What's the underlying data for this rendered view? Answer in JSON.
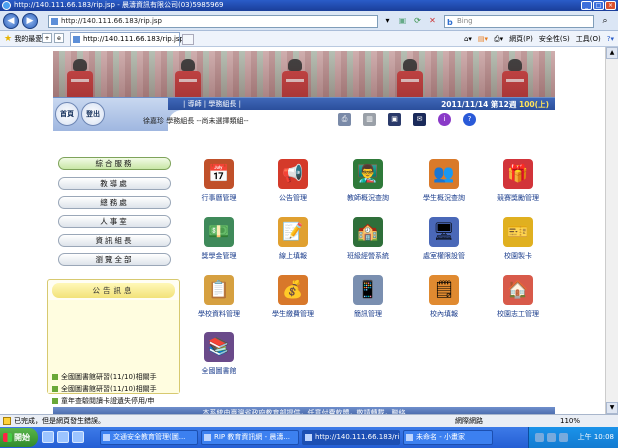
{
  "window": {
    "title": "http://140.111.66.183/rip.jsp - 晨濤資訊有限公司(03)5985969"
  },
  "addressbar": {
    "url": "http://140.111.66.183/rip.jsp",
    "search_engine": "Bing"
  },
  "favbar": {
    "favorites_label": "我的最愛",
    "tab_title": "http://140.111.66.183/rip.jsp",
    "tools": [
      "網頁(P)",
      "安全性(S)",
      "工具(O)"
    ]
  },
  "nav": {
    "home_label": "首頁",
    "logout_label": "登出",
    "role": "| 導師 | 學務組長 |",
    "date": "2011/11/14",
    "week": "第12週",
    "semester": "100(上)",
    "user": "徐嘉珍 學務組長 --尚未選擇類組--"
  },
  "menu": [
    {
      "label": "綜合服務",
      "active": true
    },
    {
      "label": "教導處",
      "active": false
    },
    {
      "label": "總務處",
      "active": false
    },
    {
      "label": "人事室",
      "active": false
    },
    {
      "label": "資訊組長",
      "active": false
    },
    {
      "label": "瀏覽全部",
      "active": false
    }
  ],
  "announcements": {
    "title": "公告訊息",
    "items": [
      "全國圖書館研習(11/10)相關手",
      "全國圖書館研習(11/10)相關手",
      "童年查驗閱讀卡證遺失停用/申"
    ]
  },
  "functions": [
    {
      "label": "行事曆管理",
      "icon": "calendar-board-icon",
      "color": "#c0502a",
      "glyph": "📅"
    },
    {
      "label": "公告管理",
      "icon": "megaphone-icon",
      "color": "#d43a2a",
      "glyph": "📢"
    },
    {
      "label": "教師概況查詢",
      "icon": "teacher-board-icon",
      "color": "#2f7a3a",
      "glyph": "👨‍🏫"
    },
    {
      "label": "學生概況查詢",
      "icon": "students-icon",
      "color": "#d97a2a",
      "glyph": "👥"
    },
    {
      "label": "競賽獎勵管理",
      "icon": "gift-icon",
      "color": "#d2343a",
      "glyph": "🎁"
    },
    {
      "label": "獎學金管理",
      "icon": "money-box-icon",
      "color": "#3f8a5a",
      "glyph": "💵"
    },
    {
      "label": "線上填報",
      "icon": "online-form-icon",
      "color": "#e0a030",
      "glyph": "📝"
    },
    {
      "label": "班級經營系統",
      "icon": "class-board-icon",
      "color": "#2f6f3a",
      "glyph": "🏫"
    },
    {
      "label": "處室權限設管",
      "icon": "permission-window-icon",
      "color": "#4a68b8",
      "glyph": "🖥"
    },
    {
      "label": "校園製卡",
      "icon": "id-card-icon",
      "color": "#e0b020",
      "glyph": "🎫"
    },
    {
      "label": "學校資料管理",
      "icon": "school-data-icon",
      "color": "#d6a040",
      "glyph": "📋"
    },
    {
      "label": "學生繳費管理",
      "icon": "payment-icon",
      "color": "#d8782a",
      "glyph": "💰"
    },
    {
      "label": "簡訊管理",
      "icon": "sms-phone-icon",
      "color": "#7a8fb0",
      "glyph": "📱"
    },
    {
      "label": "校內填報",
      "icon": "school-form-icon",
      "color": "#e08a30",
      "glyph": "🗒"
    },
    {
      "label": "校園志工管理",
      "icon": "volunteer-house-icon",
      "color": "#d85a4a",
      "glyph": "🏠"
    },
    {
      "label": "全國圖書館",
      "icon": "books-icon",
      "color": "#6a4a8a",
      "glyph": "📚"
    }
  ],
  "footer": {
    "text": "本系統由臺灣省政府教育部提供，任意付費軟體，敬請轉載，聯絡"
  },
  "status": {
    "text": "已完成，但是網頁發生錯誤。",
    "zone": "網際網路",
    "zoom": "110%"
  },
  "taskbar": {
    "start_label": "開始",
    "items": [
      {
        "label": "交通安全教育管理(圖...",
        "active": false
      },
      {
        "label": "RIP 教育資訊網 - 晨濤...",
        "active": false
      },
      {
        "label": "http://140.111.66.183/rip...",
        "active": true
      },
      {
        "label": "未命名 - 小畫家",
        "active": false
      }
    ],
    "clock": "上午 10:08"
  }
}
